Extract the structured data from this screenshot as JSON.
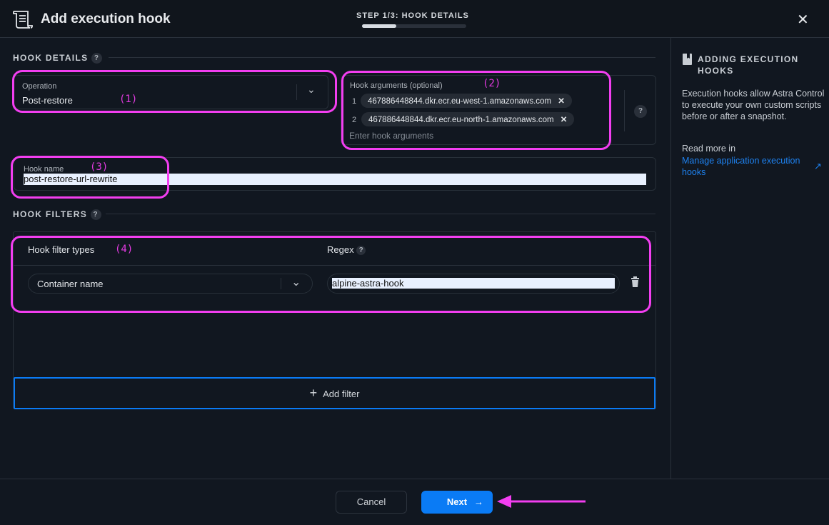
{
  "header": {
    "title": "Add execution hook",
    "step": "STEP 1/3: HOOK DETAILS",
    "progress": 0.33
  },
  "details": {
    "section": "HOOK DETAILS",
    "operation_label": "Operation",
    "operation_value": "Post-restore",
    "args_label": "Hook arguments (optional)",
    "args": [
      {
        "index": "1",
        "value": "467886448844.dkr.ecr.eu-west-1.amazonaws.com"
      },
      {
        "index": "2",
        "value": "467886448844.dkr.ecr.eu-north-1.amazonaws.com"
      }
    ],
    "args_placeholder": "Enter hook arguments",
    "hook_name_label": "Hook name",
    "hook_name_value": "post-restore-url-rewrite"
  },
  "filters": {
    "section": "HOOK FILTERS",
    "col_type": "Hook filter types",
    "col_regex": "Regex",
    "type_value": "Container name",
    "regex_value": "alpine-astra-hook",
    "add_label": "Add filter"
  },
  "help": "?",
  "side": {
    "title_line1": "ADDING EXECUTION",
    "title_line2": "HOOKS",
    "body": "Execution hooks allow Astra Control to execute your own custom scripts before or after a snapshot.",
    "read_more": "Read more in",
    "link": "Manage application execution hooks"
  },
  "footer": {
    "cancel": "Cancel",
    "next": "Next"
  },
  "annotations": [
    "(1)",
    "(2)",
    "(3)",
    "(4)"
  ],
  "colors": {
    "accent": "#0a7bf5",
    "annotation": "#f23ef0"
  }
}
